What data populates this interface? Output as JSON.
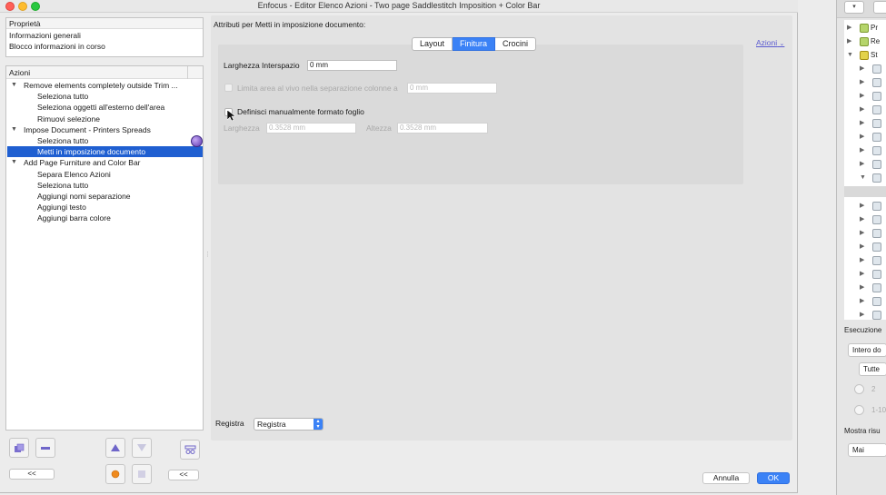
{
  "window": {
    "title": "Enfocus - Editor Elenco Azioni - Two page Saddlestitch Imposition + Color Bar"
  },
  "properties": {
    "header": "Proprietà",
    "items": [
      "Informazioni generali",
      "Blocco informazioni in corso"
    ]
  },
  "actions": {
    "header": "Azioni",
    "rows": [
      {
        "label": "Remove elements completely outside Trim ...",
        "level": 0
      },
      {
        "label": "Seleziona tutto",
        "level": 1
      },
      {
        "label": "Seleziona oggetti all'esterno dell'area",
        "level": 1
      },
      {
        "label": "Rimuovi selezione",
        "level": 1
      },
      {
        "label": "Impose Document - Printers Spreads",
        "level": 0
      },
      {
        "label": "Seleziona tutto",
        "level": 1
      },
      {
        "label": "Metti in imposizione documento",
        "level": 1,
        "selected": true
      },
      {
        "label": "Add Page Furniture and Color Bar",
        "level": 0
      },
      {
        "label": "Separa Elenco Azioni",
        "level": 1
      },
      {
        "label": "Seleziona tutto",
        "level": 1
      },
      {
        "label": "Aggiungi nomi separazione",
        "level": 1
      },
      {
        "label": "Aggiungi testo",
        "level": 1
      },
      {
        "label": "Aggiungi barra colore",
        "level": 1
      }
    ]
  },
  "nav": {
    "collapse_left": "<<",
    "collapse_right": "<<"
  },
  "attributes": {
    "title": "Attributi per Metti in imposizione documento:",
    "tabs": [
      "Layout",
      "Finitura",
      "Crocini"
    ],
    "active_tab": "Finitura",
    "azioni_link": "Azioni",
    "gap_label": "Larghezza Interspazio",
    "gap_value": "0 mm",
    "bleed_label": "Limita area al vivo nella separazione colonne a",
    "bleed_value": "0 mm",
    "manual_sheet_label": "Definisci manualmente formato foglio",
    "width_label": "Larghezza",
    "width_value": "0.3528 mm",
    "height_label": "Altezza",
    "height_value": "0.3528 mm",
    "register_label": "Registra",
    "register_value": "Registra"
  },
  "footer": {
    "cancel": "Annulla",
    "ok": "OK"
  },
  "background_window": {
    "tree_rows": [
      {
        "text": "Pr",
        "icon": "green",
        "arrow": "right"
      },
      {
        "text": "Re",
        "icon": "green",
        "arrow": "right"
      },
      {
        "text": "St",
        "icon": "yellow",
        "arrow": "down"
      }
    ],
    "esecuzione_label": "Esecuzione",
    "intero_value": "Intero do",
    "tutte_value": "Tutte",
    "radio1_value": "2",
    "radio2_value": "1-10",
    "mostra_label": "Mostra risu",
    "mai_value": "Mai"
  }
}
